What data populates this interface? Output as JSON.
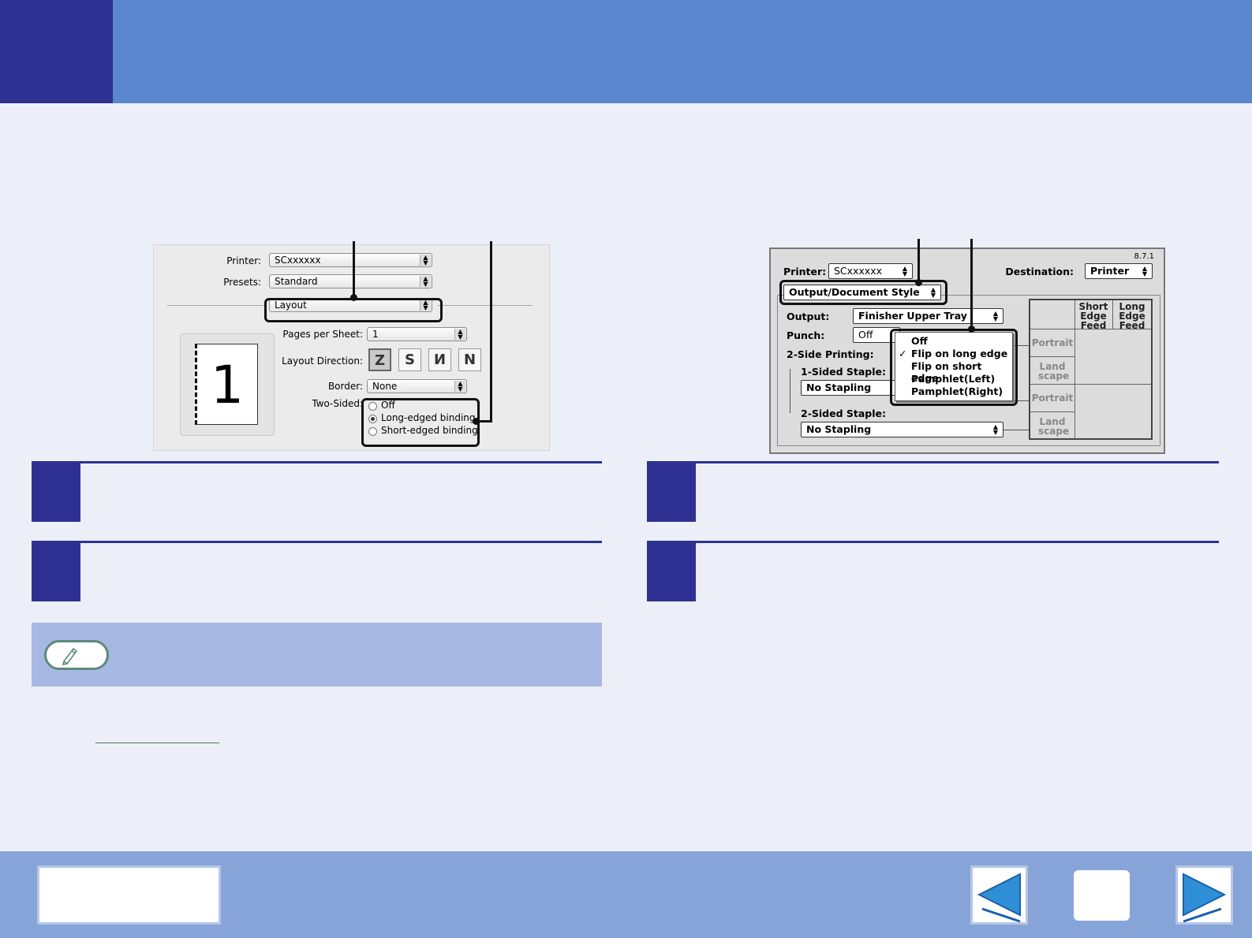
{
  "left_dialog": {
    "printer_label": "Printer:",
    "printer_value": "SCxxxxxx",
    "presets_label": "Presets:",
    "presets_value": "Standard",
    "panel_value": "Layout",
    "pages_per_sheet_label": "Pages per Sheet:",
    "pages_per_sheet_value": "1",
    "layout_direction_label": "Layout Direction:",
    "border_label": "Border:",
    "border_value": "None",
    "two_sided_label": "Two-Sided:",
    "preview_page_number": "1",
    "two_sided_options": [
      {
        "label": "Off",
        "selected": false
      },
      {
        "label": "Long-edged binding",
        "selected": true
      },
      {
        "label": "Short-edged binding",
        "selected": false
      }
    ]
  },
  "right_dialog": {
    "version": "8.7.1",
    "printer_label": "Printer:",
    "printer_value": "SCxxxxxx",
    "destination_label": "Destination:",
    "destination_value": "Printer",
    "panel_value": "Output/Document Style",
    "output_label": "Output:",
    "output_value": "Finisher Upper Tray",
    "punch_label": "Punch:",
    "punch_value": "Off",
    "two_side_label": "2-Side Printing:",
    "one_sided_staple_label": "1-Sided Staple:",
    "one_sided_staple_value": "No Stapling",
    "two_sided_staple_label": "2-Sided Staple:",
    "two_sided_staple_value": "No Stapling",
    "two_side_menu": [
      {
        "label": "Off",
        "checked": false
      },
      {
        "label": "Flip on long edge",
        "checked": true
      },
      {
        "label": "Flip on short edge",
        "checked": false
      },
      {
        "label": "Pamphlet(Left)",
        "checked": false
      },
      {
        "label": "Pamphlet(Right)",
        "checked": false
      }
    ],
    "table": {
      "col_short": "Short Edge Feed",
      "col_long": "Long Edge Feed",
      "row1": "Portrait",
      "row2": "Land scape",
      "row3": "Portrait",
      "row4": "Land scape"
    }
  },
  "colors": {
    "header": "#5a87cd",
    "accent": "#2f3192",
    "background": "#eceff8",
    "footer": "#86a4d8",
    "note": "#a7b8e3"
  },
  "icons": {
    "note": "pencil-icon",
    "prev": "triangle-left-icon",
    "next": "triangle-right-icon"
  }
}
